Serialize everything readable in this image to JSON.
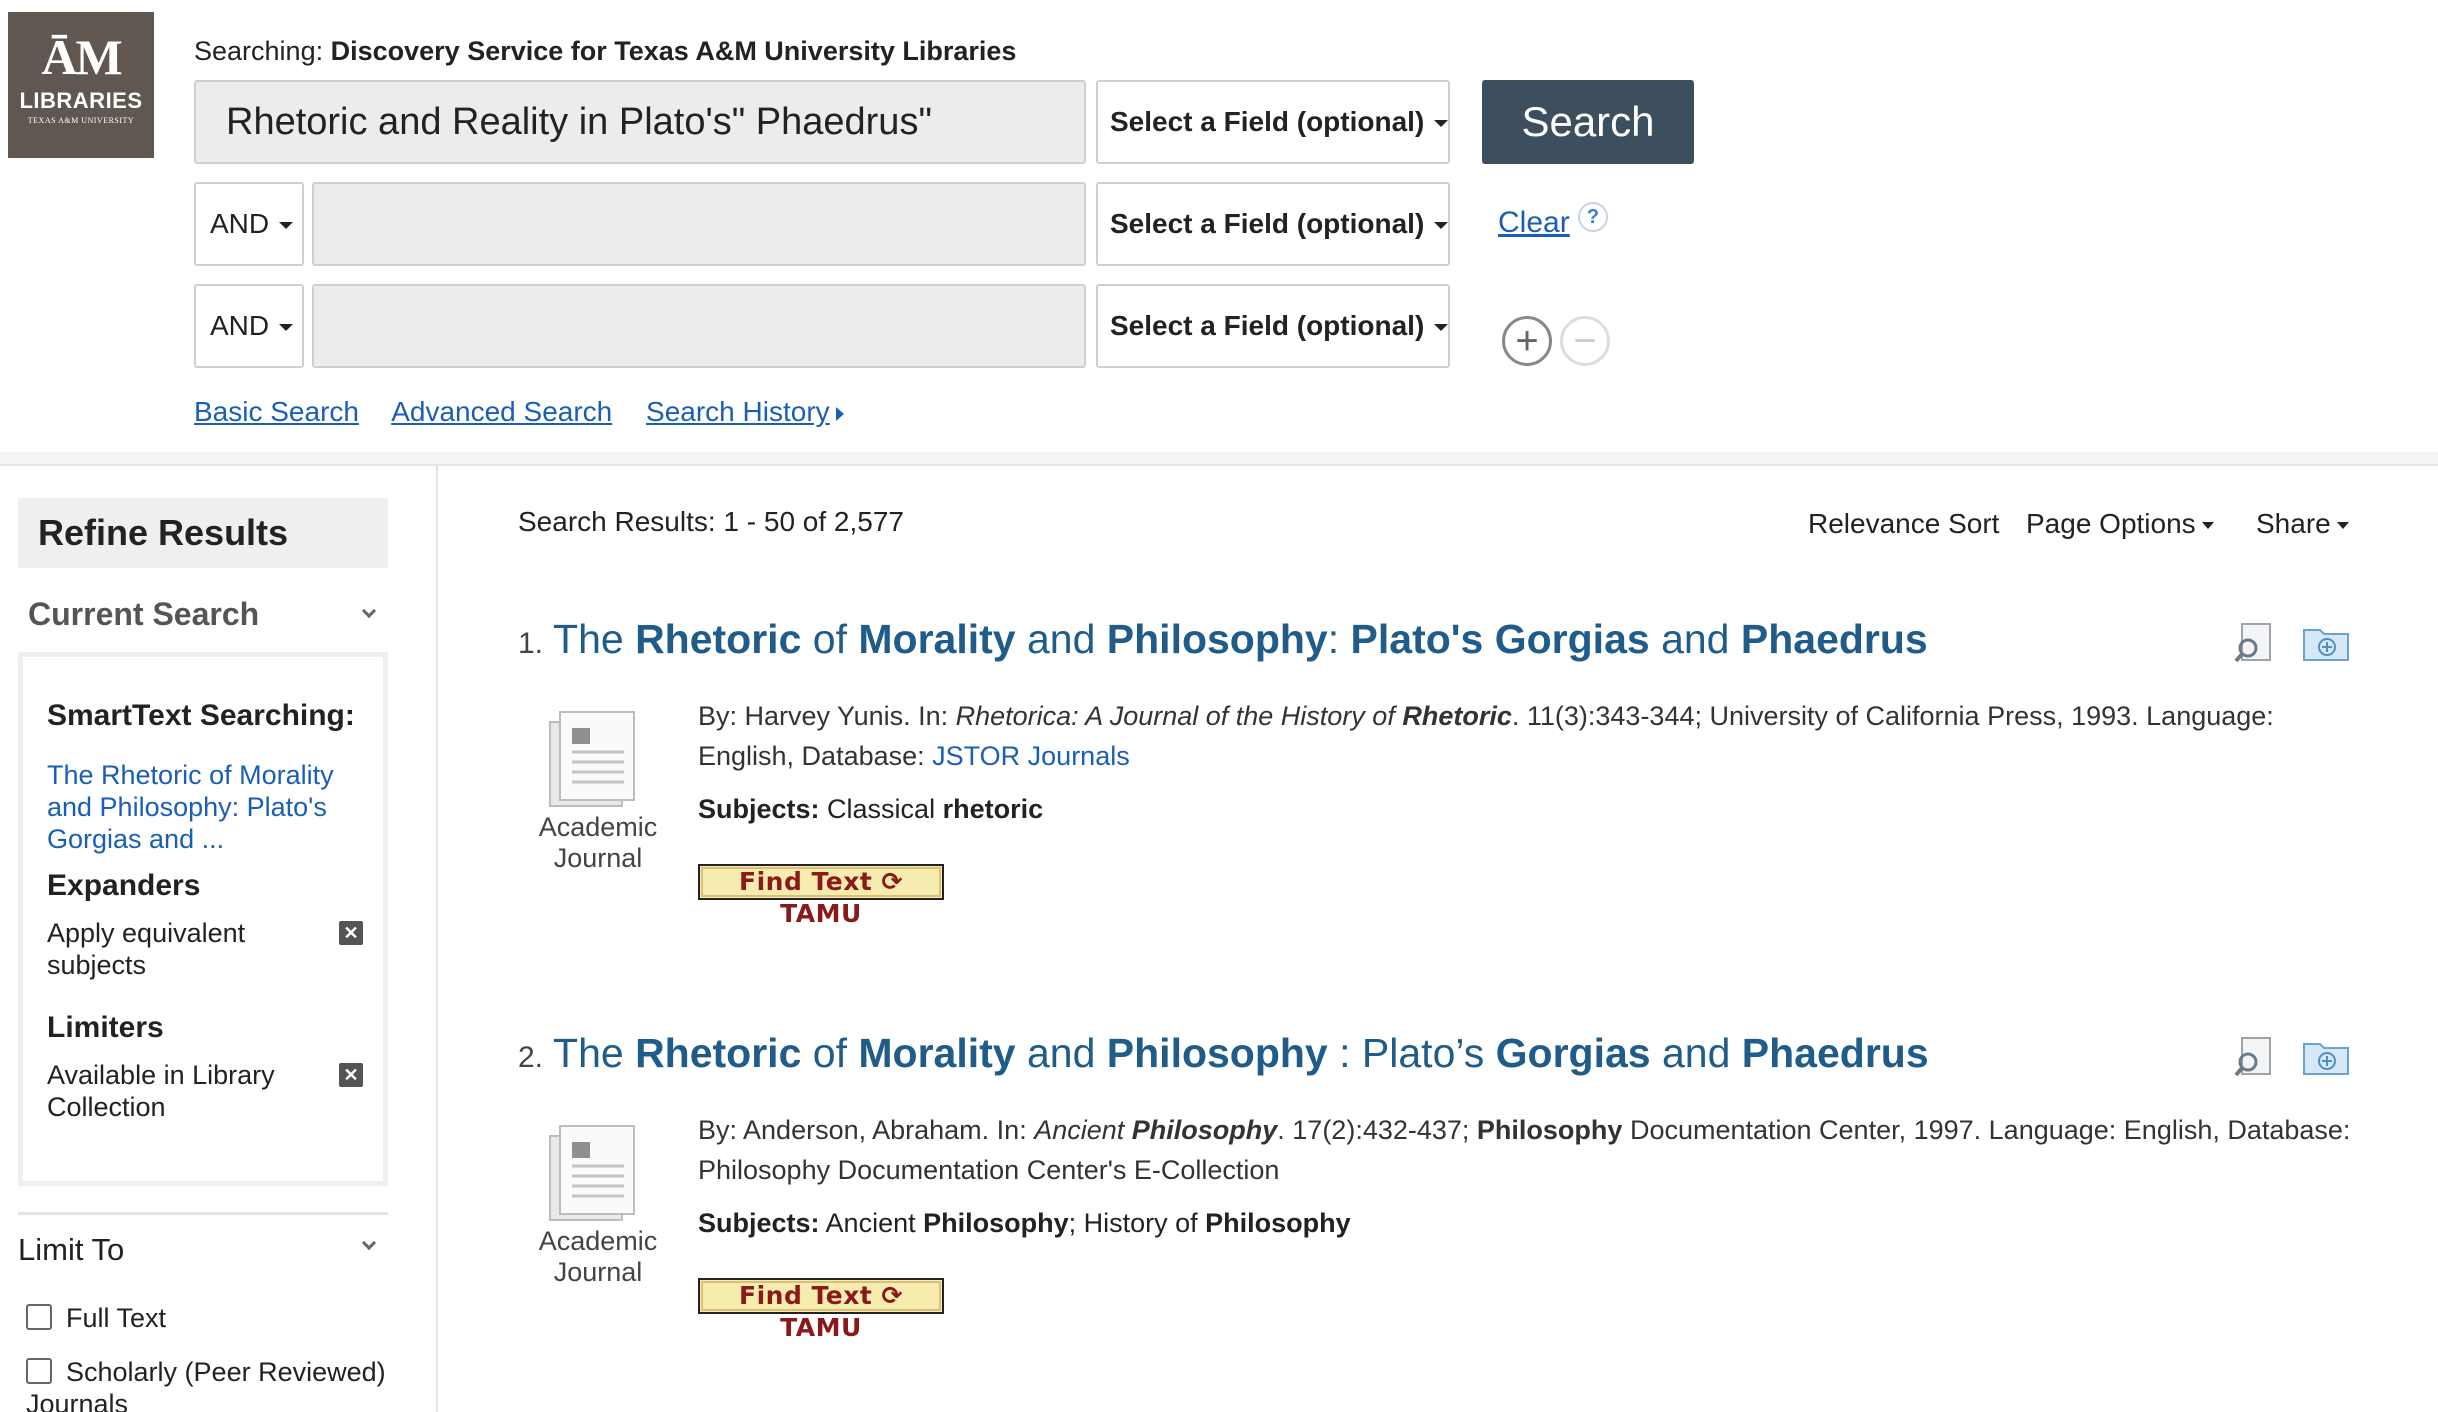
{
  "logo": {
    "mark": "ĀM",
    "name": "LIBRARIES",
    "subtitle": "TEXAS A&M UNIVERSITY"
  },
  "search": {
    "searching_prefix": "Searching:",
    "searching_target": "Discovery Service for Texas A&M University Libraries",
    "query": "Rhetoric and Reality in Plato's\" Phaedrus\"",
    "field_placeholder": "Select a Field (optional)",
    "search_button": "Search",
    "rows": [
      {
        "bool": "AND",
        "value": "",
        "field": "Select a Field (optional)"
      },
      {
        "bool": "AND",
        "value": "",
        "field": "Select a Field (optional)"
      }
    ],
    "clear_label": "Clear",
    "help_label": "?",
    "add_row": "+",
    "remove_row": "−"
  },
  "nav": {
    "basic": "Basic Search",
    "advanced": "Advanced Search",
    "history": "Search History"
  },
  "sidebar": {
    "refine_title": "Refine Results",
    "current_search": "Current Search",
    "smarttext_head": "SmartText Searching:",
    "smarttext_link": "The Rhetoric of Morality and Philosophy: Plato's Gorgias and ...",
    "expanders_head": "Expanders",
    "expander_item": "Apply equivalent subjects",
    "limiters_head": "Limiters",
    "limiter_item": "Available in Library Collection",
    "limit_to": "Limit To",
    "limit_options": [
      "Full Text",
      "Scholarly (Peer Reviewed) Journals"
    ]
  },
  "results_header": {
    "count_text": "Search Results: 1 - 50 of 2,577",
    "sort": "Relevance Sort",
    "page_options": "Page Options",
    "share": "Share"
  },
  "results": [
    {
      "number": "1.",
      "title_parts": [
        [
          "The ",
          false
        ],
        [
          "Rhetoric",
          true
        ],
        [
          " of ",
          false
        ],
        [
          "Morality",
          true
        ],
        [
          " and ",
          false
        ],
        [
          "Philosophy",
          true
        ],
        [
          ": ",
          false
        ],
        [
          "Plato's",
          true
        ],
        [
          " ",
          false
        ],
        [
          "Gorgias",
          true
        ],
        [
          " and ",
          false
        ],
        [
          "Phaedrus",
          true
        ]
      ],
      "type_line1": "Academic",
      "type_line2": "Journal",
      "meta_before": "By: Harvey Yunis. In: ",
      "meta_journal": "Rhetorica: A Journal of the History of ",
      "meta_journal_bold": "Rhetoric",
      "meta_after": ". 11(3):343-344; University of California Press, 1993. Language: English, Database: ",
      "meta_database": "JSTOR Journals",
      "subjects_label": "Subjects:",
      "subjects_plain": "Classical ",
      "subjects_bold": "rhetoric",
      "find_text": "Find Text ⟳ TAMU"
    },
    {
      "number": "2.",
      "title_parts": [
        [
          "The ",
          false
        ],
        [
          "Rhetoric",
          true
        ],
        [
          " of ",
          false
        ],
        [
          "Morality",
          true
        ],
        [
          " and ",
          false
        ],
        [
          "Philosophy",
          true
        ],
        [
          " : Plato’s ",
          false
        ],
        [
          "Gorgias",
          true
        ],
        [
          " and ",
          false
        ],
        [
          "Phaedrus",
          true
        ]
      ],
      "type_line1": "Academic",
      "type_line2": "Journal",
      "meta_before": "By: Anderson, Abraham. In: ",
      "meta_journal": "Ancient ",
      "meta_journal_bold": "Philosophy",
      "meta_after2_prefix": ". 17(2):432-437; ",
      "meta_after2_bold": "Philosophy",
      "meta_after2_suffix": " Documentation Center, 1997. Language: English, Database: Philosophy Documentation Center's E-Collection",
      "subjects_label": "Subjects:",
      "subjects_p1": "Ancient ",
      "subjects_b1": "Philosophy",
      "subjects_p2": "; History of ",
      "subjects_b2": "Philosophy",
      "find_text": "Find Text ⟳ TAMU"
    }
  ],
  "colors": {
    "search_button_bg": "#3d4e5e",
    "link_blue": "#1a5fb4",
    "title_blue": "#1f5c8a",
    "logo_bg": "#5f5750",
    "findtext_bg": "#f6ecb0",
    "findtext_fg": "#8a1a1a"
  }
}
